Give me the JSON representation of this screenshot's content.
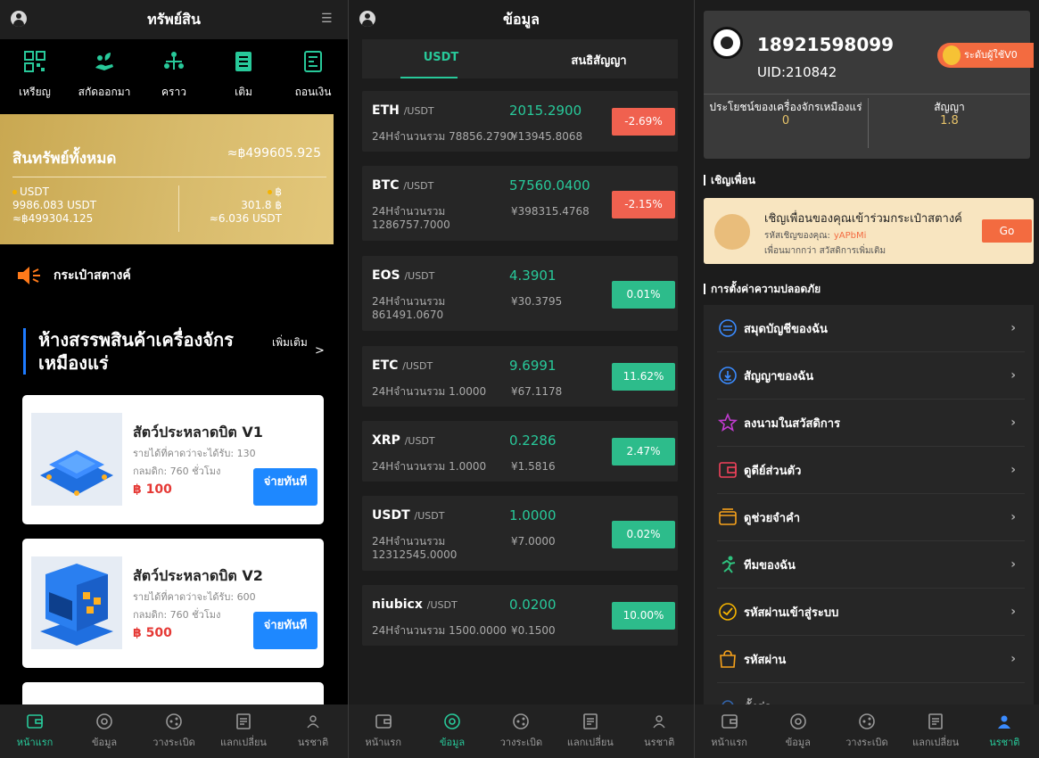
{
  "p1": {
    "title": "ทรัพย์สิน",
    "actions": [
      "เหรียญ",
      "สกัดออกมา",
      "คราว",
      "เติม",
      "ถอนเงิน"
    ],
    "assets": {
      "total_label": "สินทรัพย์ทั้งหมด",
      "total_value": "≈฿499605.925",
      "usdt_label": "USDT",
      "usdt_amount": "9986.083 USDT",
      "usdt_baht": "≈฿499304.125",
      "baht_label": "฿",
      "baht_amount": "301.8 ฿",
      "baht_usdt": "≈6.036 USDT"
    },
    "wallet_label": "กระเป๋าสตางค์",
    "mall": {
      "title": "ห้างสรรพสินค้าเครื่องจักรเหมืองแร่",
      "more": "เพิ่มเติม",
      "arrow": ">"
    },
    "products": [
      {
        "name": "สัตว์ประหลาดบิต V1",
        "income": "รายได้ที่คาดว่าจะได้รับ: 130",
        "cycle": "กลมดิก: 760 ชั่วโมง",
        "price": "฿ 100",
        "buy": "จ่ายทันที"
      },
      {
        "name": "สัตว์ประหลาดบิต V2",
        "income": "รายได้ที่คาดว่าจะได้รับ: 600",
        "cycle": "กลมดิก: 760 ชั่วโมง",
        "price": "฿ 500",
        "buy": "จ่ายทันที"
      }
    ]
  },
  "p2": {
    "title": "ข้อมูล",
    "tabs": [
      "USDT",
      "สนธิสัญญา"
    ],
    "coins": [
      {
        "name": "ETH",
        "pair": "/USDT",
        "price": "2015.2900",
        "vol": "24Hจำนวนรวม 78856.2790",
        "cny": "¥13945.8068",
        "chg": "-2.69%",
        "dir": "down"
      },
      {
        "name": "BTC",
        "pair": "/USDT",
        "price": "57560.0400",
        "vol": "24Hจำนวนรวม 1286757.7000",
        "cny": "¥398315.4768",
        "chg": "-2.15%",
        "dir": "down"
      },
      {
        "name": "EOS",
        "pair": "/USDT",
        "price": "4.3901",
        "vol": "24Hจำนวนรวม 861491.0670",
        "cny": "¥30.3795",
        "chg": "0.01%",
        "dir": "up"
      },
      {
        "name": "ETC",
        "pair": "/USDT",
        "price": "9.6991",
        "vol": "24Hจำนวนรวม 1.0000",
        "cny": "¥67.1178",
        "chg": "11.62%",
        "dir": "up"
      },
      {
        "name": "XRP",
        "pair": "/USDT",
        "price": "0.2286",
        "vol": "24Hจำนวนรวม 1.0000",
        "cny": "¥1.5816",
        "chg": "2.47%",
        "dir": "up"
      },
      {
        "name": "USDT",
        "pair": "/USDT",
        "price": "1.0000",
        "vol": "24Hจำนวนรวม 12312545.0000",
        "cny": "¥7.0000",
        "chg": "0.02%",
        "dir": "up"
      },
      {
        "name": "niubicx",
        "pair": "/USDT",
        "price": "0.0200",
        "vol": "24Hจำนวนรวม 1500.0000",
        "cny": "¥0.1500",
        "chg": "10.00%",
        "dir": "up"
      }
    ]
  },
  "p3": {
    "phone": "18921598099",
    "uid": "UID:210842",
    "level": "ระดับผู้ใช้V0",
    "stat1_label": "ประโยชน์ของเครื่องจักรเหมืองแร่",
    "stat1_value": "0",
    "stat2_label": "สัญญา",
    "stat2_value": "1.8",
    "invite_section": "เชิญเพื่อน",
    "invite": {
      "title": "เชิญเพื่อนของคุณเข้าร่วมกระเป๋าสตางค์",
      "code_label": "รหัสเชิญของคุณ:",
      "code": "yAPbMi",
      "note": "เพื่อนมากกว่า สวัสดิการเพิ่มเติม",
      "go": "Go"
    },
    "security_section": "การตั้งค่าความปลอดภัย",
    "menu": [
      "สมุดบัญชีของฉัน",
      "สัญญาของฉัน",
      "ลงนามในสวัสดิการ",
      "ดูดีย์ส่วนตัว",
      "ดูช่วยจำคำ",
      "ทีมของฉัน",
      "รหัสผ่านเข้าสู่ระบบ",
      "รหัสผ่าน",
      "ตั้งค่า"
    ]
  },
  "tabbar": [
    "หน้าแรก",
    "ข้อมูล",
    "วางระเบิด",
    "แลกเปลี่ยน",
    "นรชาติ"
  ],
  "colors": {
    "accent": "#28c99a",
    "gold": "#d4b461",
    "down": "#f0614f",
    "up": "#2dbc8b",
    "orange": "#f36b40"
  }
}
